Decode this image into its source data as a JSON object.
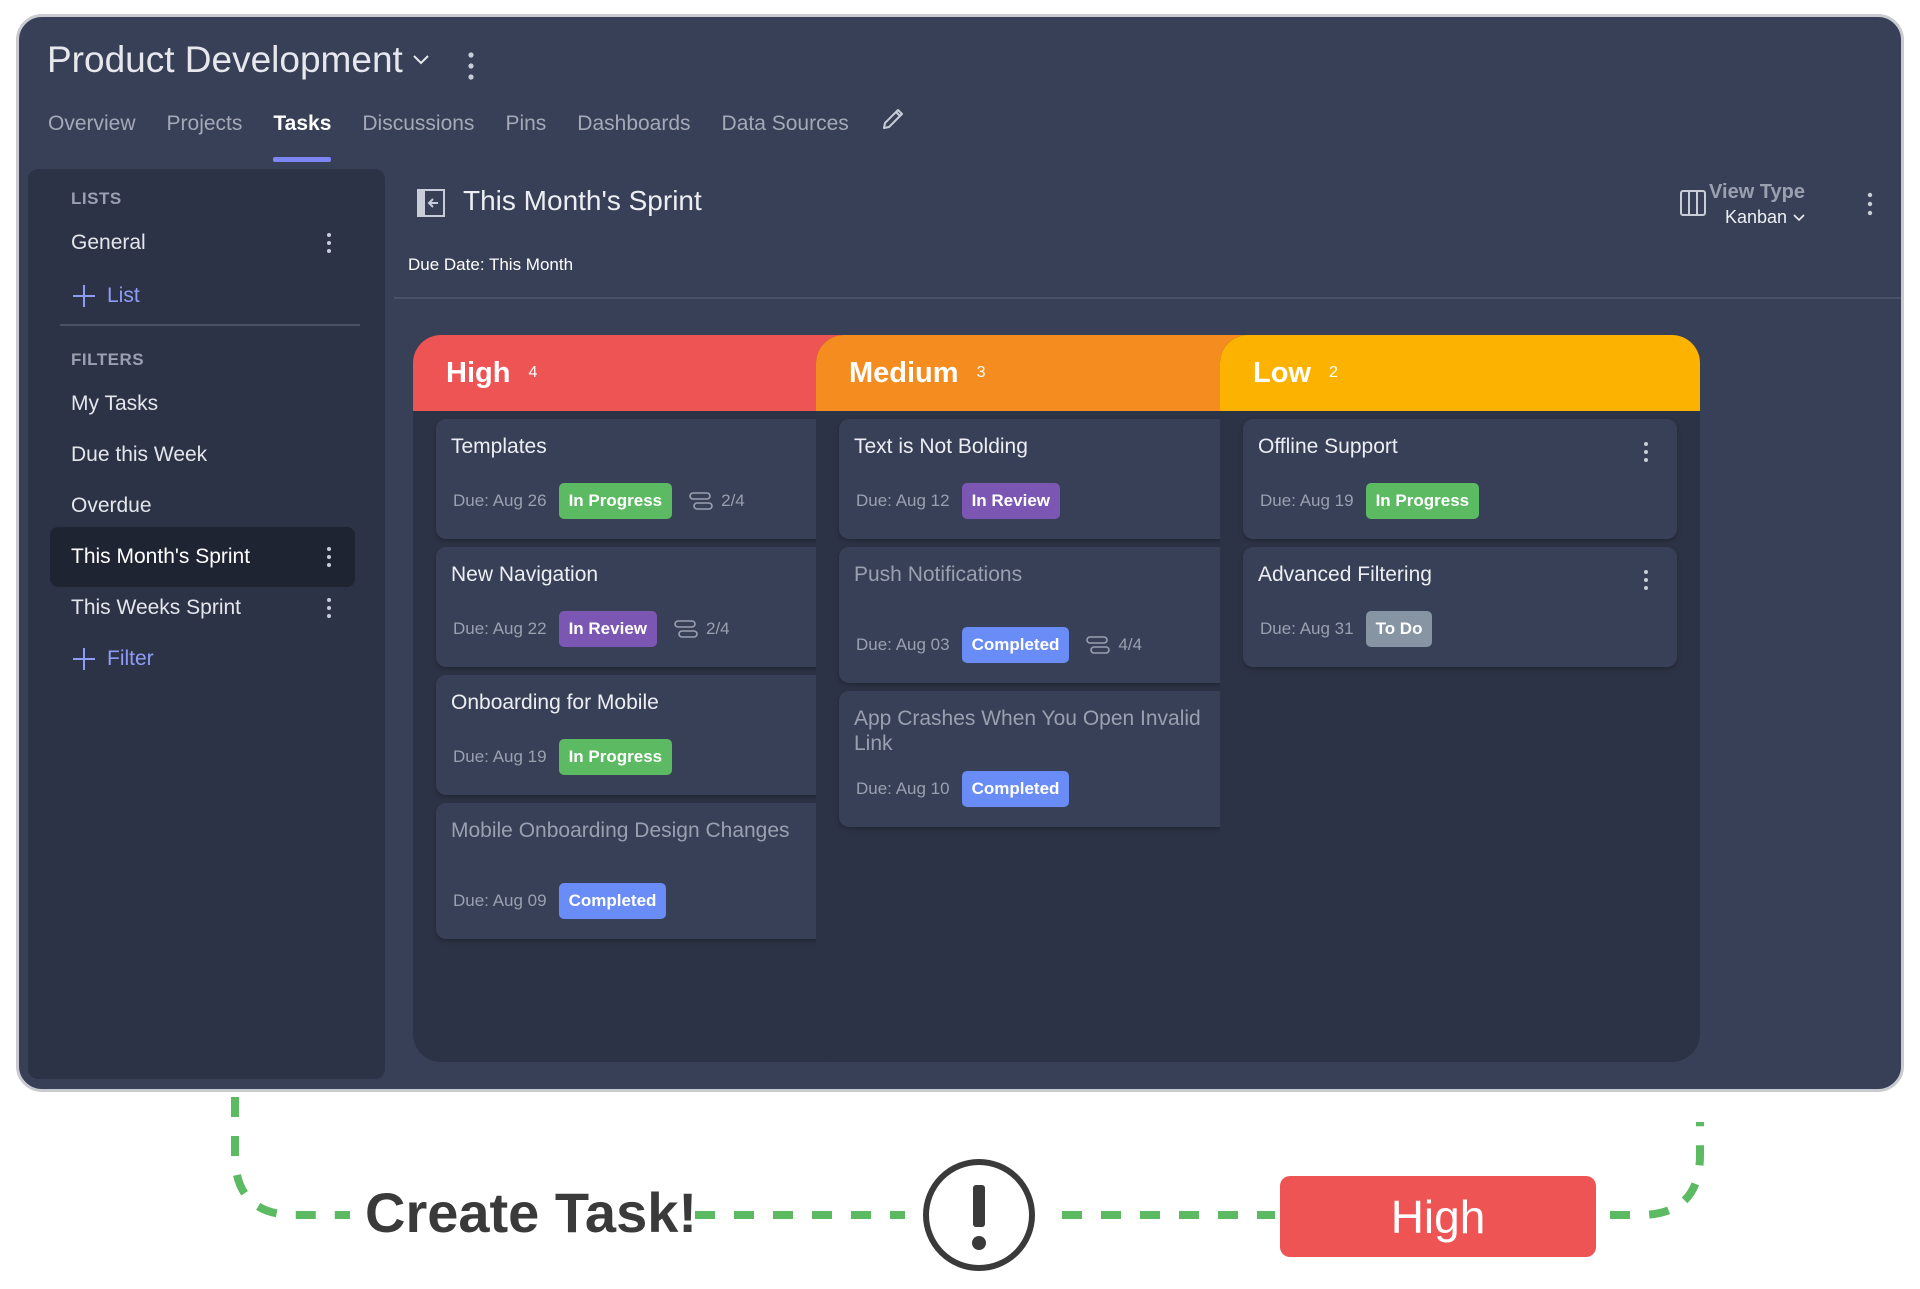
{
  "workspace": {
    "title": "Product Development"
  },
  "tabs": [
    "Overview",
    "Projects",
    "Tasks",
    "Discussions",
    "Pins",
    "Dashboards",
    "Data Sources"
  ],
  "active_tab": "Tasks",
  "sidebar": {
    "lists_heading": "LISTS",
    "lists": [
      "General"
    ],
    "add_list_label": "List",
    "filters_heading": "FILTERS",
    "filters": [
      "My Tasks",
      "Due this Week",
      "Overdue",
      "This Month's Sprint",
      "This Weeks Sprint"
    ],
    "active_filter": "This Month's Sprint",
    "add_filter_label": "Filter"
  },
  "main": {
    "title": "This Month's Sprint",
    "due_filter": "Due Date: This Month",
    "view_type_label": "View Type",
    "view_type_value": "Kanban"
  },
  "columns": [
    {
      "title": "High",
      "count": "4",
      "color": "#ef5454",
      "cards": [
        {
          "title": "Templates",
          "due": "Due:  Aug 26",
          "status": "In Progress",
          "subtasks": "2/4"
        },
        {
          "title": "New Navigation",
          "due": "Due:  Aug 22",
          "status": "In Review",
          "subtasks": "2/4"
        },
        {
          "title": "Onboarding for Mobile",
          "due": "Due:  Aug 19",
          "status": "In Progress"
        },
        {
          "title": "Mobile Onboarding Design Changes",
          "due": "Due:  Aug 09",
          "status": "Completed"
        }
      ]
    },
    {
      "title": "Medium",
      "count": "3",
      "color": "#f48c20",
      "cards": [
        {
          "title": "Text is Not Bolding",
          "due": "Due:  Aug 12",
          "status": "In Review"
        },
        {
          "title": "Push Notifications",
          "due": "Due:  Aug 03",
          "status": "Completed",
          "subtasks": "4/4"
        },
        {
          "title": "App Crashes When You Open Invalid Link",
          "due": "Due:  Aug 10",
          "status": "Completed"
        }
      ]
    },
    {
      "title": "Low",
      "count": "2",
      "color": "#fcb200",
      "cards": [
        {
          "title": "Offline Support",
          "due": "Due:  Aug 19",
          "status": "In Progress"
        },
        {
          "title": "Advanced Filtering",
          "due": "Due:  Aug 31",
          "status": "To Do"
        }
      ]
    }
  ],
  "status_colors": {
    "In Progress": "#5cba63",
    "In Review": "#7c56b3",
    "Completed": "#6a8cf7",
    "To Do": "#8694a3"
  },
  "flow": {
    "caption": "Create Task!",
    "badge_label": "High",
    "badge_color": "#ef5454",
    "line_color": "#5cba63",
    "icon": "exclamation-circle-icon"
  }
}
